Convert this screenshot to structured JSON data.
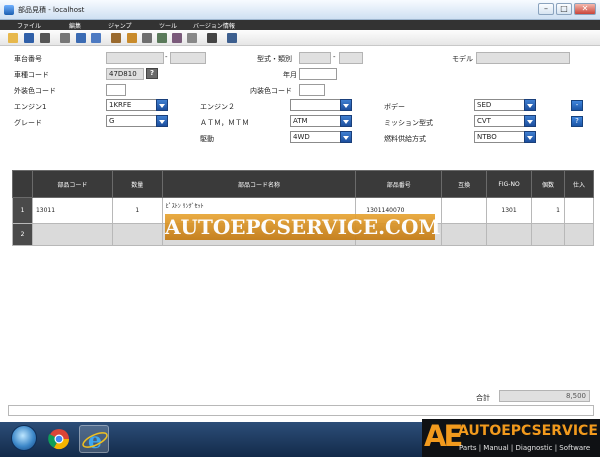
{
  "window": {
    "title": "部品見積 - localhost"
  },
  "menu": [
    "ファイル",
    "編集",
    "ジャンプ",
    "ツール",
    "バージョン情報"
  ],
  "toolbar_icons": [
    "folder-icon",
    "save-icon",
    "print-icon",
    "search-icon",
    "picture-icon",
    "grid-icon",
    "document-icon",
    "person-icon",
    "table-icon",
    "sheet-icon",
    "stamp-icon",
    "keyboard-icon",
    "print-icon",
    "calculator-icon"
  ],
  "form": {
    "chassis_label": "車台番号",
    "chassis_sep": "-",
    "type_label": "型式・類別",
    "type_sep": "-",
    "model_label": "モデル",
    "model_code_label": "車種コード",
    "model_code_value": "47D810",
    "model_code_btn": "?",
    "year_label": "年月",
    "ext_color_label": "外装色コード",
    "int_color_label": "内装色コード",
    "engine1_label": "エンジン1",
    "engine1_value": "1KRFE",
    "engine2_label": "エンジン２",
    "engine2_value": "",
    "body_label": "ボデー",
    "body_value": "SED",
    "grade_label": "グレード",
    "grade_value": "G",
    "atm_label": "ＡＴＭ，ＭＴＭ",
    "atm_value": "ATM",
    "mission_label": "ミッション型式",
    "mission_value": "CVT",
    "drive_label": "駆動",
    "drive_value": "4WD",
    "fuel_label": "燃料供給方式",
    "fuel_value": "NTBO",
    "side_btn": "-",
    "help_btn": "?"
  },
  "table": {
    "headers": [
      "",
      "部品コード",
      "数量",
      "部品コード名称",
      "部品番号",
      "互換",
      "FIG-NO",
      "個数",
      "仕入"
    ],
    "rows": [
      {
        "num": "1",
        "code": "13011",
        "qty": "1",
        "name": "ﾋﾟｽﾄﾝ ﾘﾝｸﾞｾｯﾄ",
        "part_no": "1301140070",
        "compat": "",
        "fig": "1301",
        "count": "1",
        "shiire": ""
      },
      {
        "num": "2",
        "code": "",
        "qty": "",
        "name": "",
        "part_no": "",
        "compat": "",
        "fig": "",
        "count": "",
        "shiire": ""
      }
    ]
  },
  "watermark": "AUTOEPCSERVICE.COM",
  "total": {
    "label": "合計",
    "value": "8,500"
  },
  "logo": {
    "mark": "AE",
    "brand": "AUTOEPCSERVICE",
    "tagline": "Parts | Manual | Diagnostic | Software"
  },
  "colors": {
    "accent_blue": "#1c4f9e",
    "header_dark": "#3a3a3a",
    "logo_orange": "#f29a1d"
  }
}
